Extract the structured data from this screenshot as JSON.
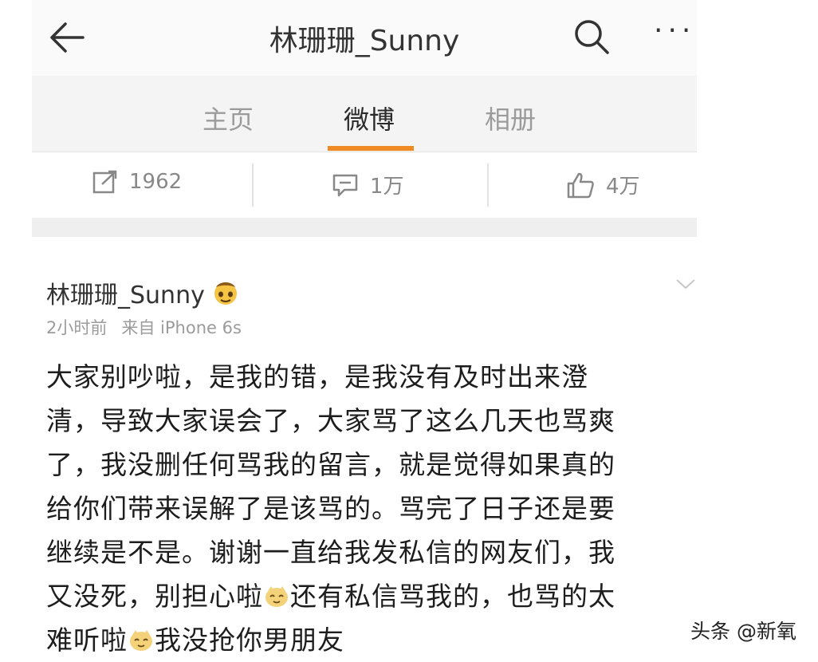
{
  "header": {
    "title": "林珊珊_Sunny",
    "back_icon": "arrow-left-icon",
    "search_icon": "search-icon",
    "more_label": "···"
  },
  "tabs": [
    {
      "label": "主页",
      "active": false
    },
    {
      "label": "微博",
      "active": true
    },
    {
      "label": "相册",
      "active": false
    }
  ],
  "tab_accent": "#f08a24",
  "stats": {
    "reposts": "1962",
    "comments": "1万",
    "likes": "4万"
  },
  "post": {
    "author": "林珊珊_Sunny",
    "time": "2小时前",
    "source": "来自 iPhone 6s",
    "lines": [
      "大家别吵啦，是我的错，是我没有及时出来澄",
      "清，导致大家误会了，大家骂了这么几天也骂爽",
      "了，我没删任何骂我的留言，就是觉得如果真的",
      "给你们带来误解了是该骂的。骂完了日子还是要",
      "继续是不是。谢谢一直给我发私信的网友们，我",
      "又没死，别担心啦",
      "还有私信骂我的，也骂的太",
      "难听啦",
      "我没抢你男朋友"
    ]
  },
  "watermark": "头条 @新氧"
}
